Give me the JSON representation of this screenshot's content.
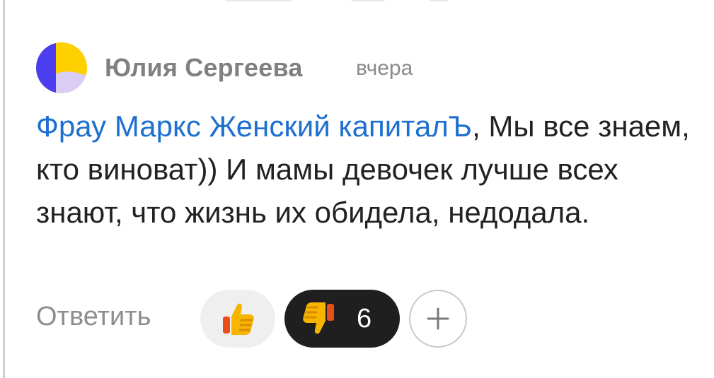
{
  "comment": {
    "author": "Юлия Сергеева",
    "timestamp": "вчера",
    "mention": "Фрау Маркс Женский капиталЪ",
    "text": ", Мы все знаем, кто виноват)) И мамы девочек лучше всех знают, что жизнь их обидела, недодала."
  },
  "actions": {
    "reply_label": "Ответить",
    "like_icon": "thumbs-up-icon",
    "dislike_icon": "thumbs-down-icon",
    "dislike_count": "6",
    "add_reaction_icon": "plus-icon"
  },
  "colors": {
    "mention": "#1d6fd0",
    "avatar_blue": "#4a3ef0",
    "avatar_yellow": "#ffd000",
    "avatar_lavender": "#d9ccf5",
    "dislike_bg": "#1f1f1f"
  }
}
